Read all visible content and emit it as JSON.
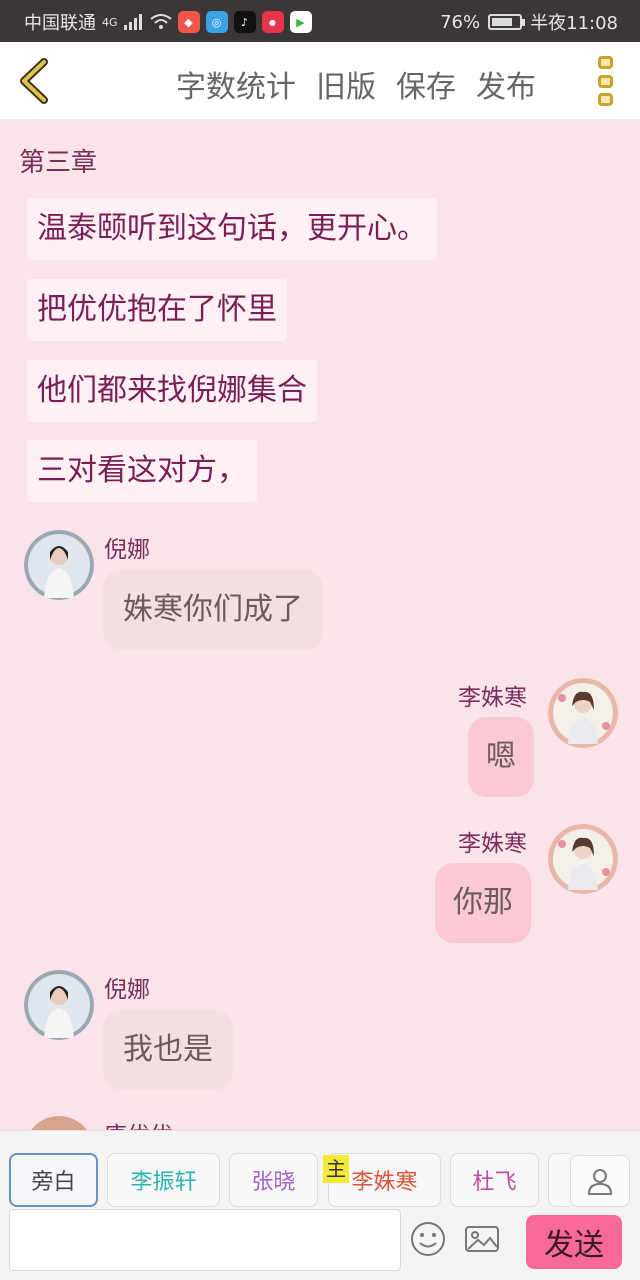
{
  "status_bar": {
    "carrier": "中国联通",
    "network": "4G",
    "battery": "76%",
    "battery_fraction": 0.76,
    "time": "半夜11:08",
    "app_icons": [
      "wifi-icon",
      "app-icon-1",
      "app-icon-2",
      "tiktok-icon",
      "xiaohongshu-icon",
      "video-app-icon"
    ]
  },
  "toolbar": {
    "back_icon": "chevron-left-icon",
    "actions": [
      "字数统计",
      "旧版",
      "保存",
      "发布"
    ],
    "more_icon": "more-vertical-icon"
  },
  "story": {
    "chapter": "第三章",
    "narrations": [
      "温泰颐听到这句话，更开心。",
      "把优优抱在了怀里",
      "他们都来找倪娜集合",
      "三对看这对方，"
    ],
    "messages": [
      {
        "speaker": "倪娜",
        "side": "left",
        "text": "姝寒你们成了"
      },
      {
        "speaker": "李姝寒",
        "side": "right",
        "text": "嗯"
      },
      {
        "speaker": "李姝寒",
        "side": "right",
        "text": "你那"
      },
      {
        "speaker": "倪娜",
        "side": "left",
        "text": "我也是"
      }
    ],
    "partial_speaker": "唐优优"
  },
  "characters": [
    {
      "name": "旁白",
      "color": "#555555",
      "selected": true
    },
    {
      "name": "李振轩",
      "color": "#2bb3b0"
    },
    {
      "name": "张晓",
      "color": "#a062c8"
    },
    {
      "name": "李姝寒",
      "color": "#d8553a",
      "tag": "主"
    },
    {
      "name": "杜飞",
      "color": "#c24da0"
    }
  ],
  "input": {
    "value": "",
    "placeholder": ""
  },
  "send_label": "发送",
  "icons": {
    "emoji": "emoji-icon",
    "image": "image-icon",
    "user": "user-icon"
  },
  "colors": {
    "background": "#fbe3ea",
    "send": "#f76a98",
    "accent": "#c9a227"
  }
}
